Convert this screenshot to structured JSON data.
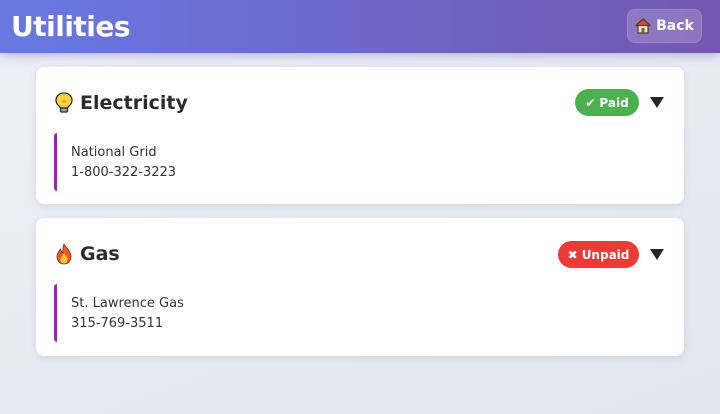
{
  "header": {
    "title": "Utilities",
    "back_label": "Back",
    "back_icon": "house-icon"
  },
  "utilities": [
    {
      "name": "Electricity",
      "icon": "lightbulb-icon",
      "status": "Paid",
      "status_icon": "checkmark-icon",
      "status_color": "#4caf50",
      "provider": "National Grid",
      "phone": "1-800-322-3223"
    },
    {
      "name": "Gas",
      "icon": "fire-icon",
      "status": "Unpaid",
      "status_icon": "x-icon",
      "status_color": "#ec3b36",
      "provider": "St. Lawrence Gas",
      "phone": "315-769-3511"
    }
  ],
  "colors": {
    "header_start": "#6778e2",
    "header_end": "#7457b0",
    "detail_accent": "#8e2bb0"
  }
}
